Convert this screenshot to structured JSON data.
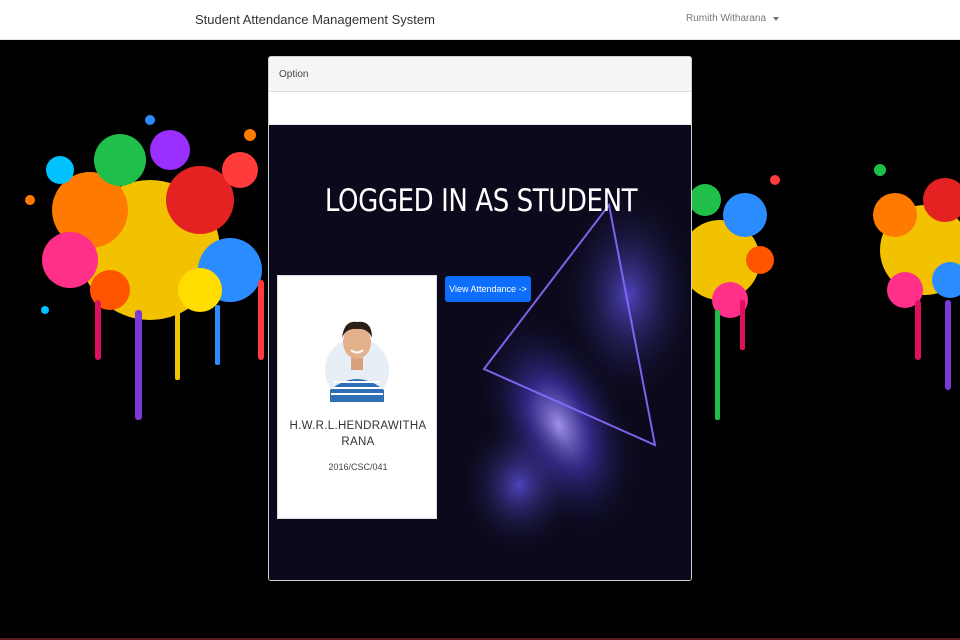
{
  "navbar": {
    "brand": "Student Attendance Management System",
    "user_name": "Rumith Witharana",
    "user_menu_icon": "caret-down-icon"
  },
  "card": {
    "header_label": "Option",
    "hero_title": "LOGGED IN AS STUDENT",
    "view_button_label": "View Attendance ->",
    "profile": {
      "name": "H.W.R.L.HENDRAWITHARANA",
      "student_id": "2016/CSC/041",
      "avatar_icon": "student-avatar"
    }
  },
  "colors": {
    "primary_button": "#0d6efd",
    "hero_background": "#0b0a1c",
    "page_background": "#000000"
  }
}
